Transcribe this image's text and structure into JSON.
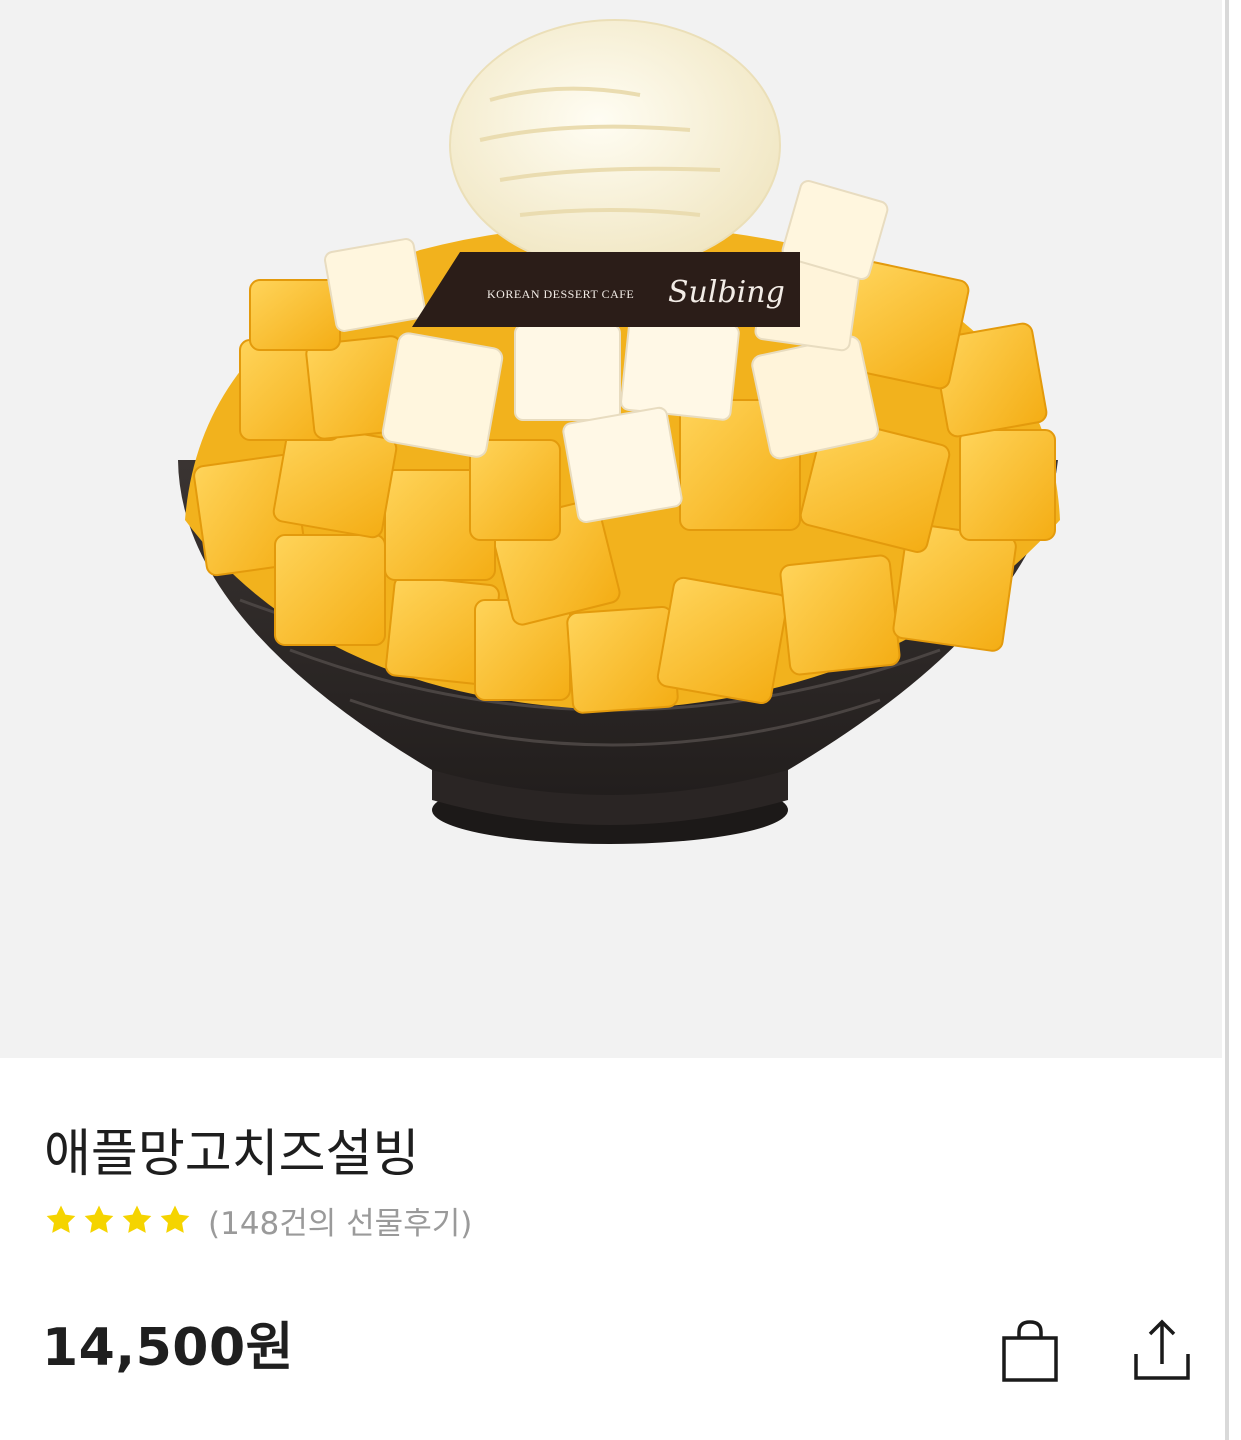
{
  "product": {
    "image": {
      "brand_tag_small": "KOREAN DESSERT CAFE",
      "brand_tag_script": "Sulbing"
    },
    "name": "애플망고치즈설빙",
    "rating": {
      "stars": 4,
      "review_count_text": "(148건의 선물후기)"
    },
    "price": "14,500원"
  },
  "actions": {
    "cart_icon": "shopping-bag-icon",
    "share_icon": "share-icon"
  },
  "colors": {
    "star": "#f5d400",
    "review_text": "#9a9a9a",
    "hero_background": "#f2f2f2"
  }
}
